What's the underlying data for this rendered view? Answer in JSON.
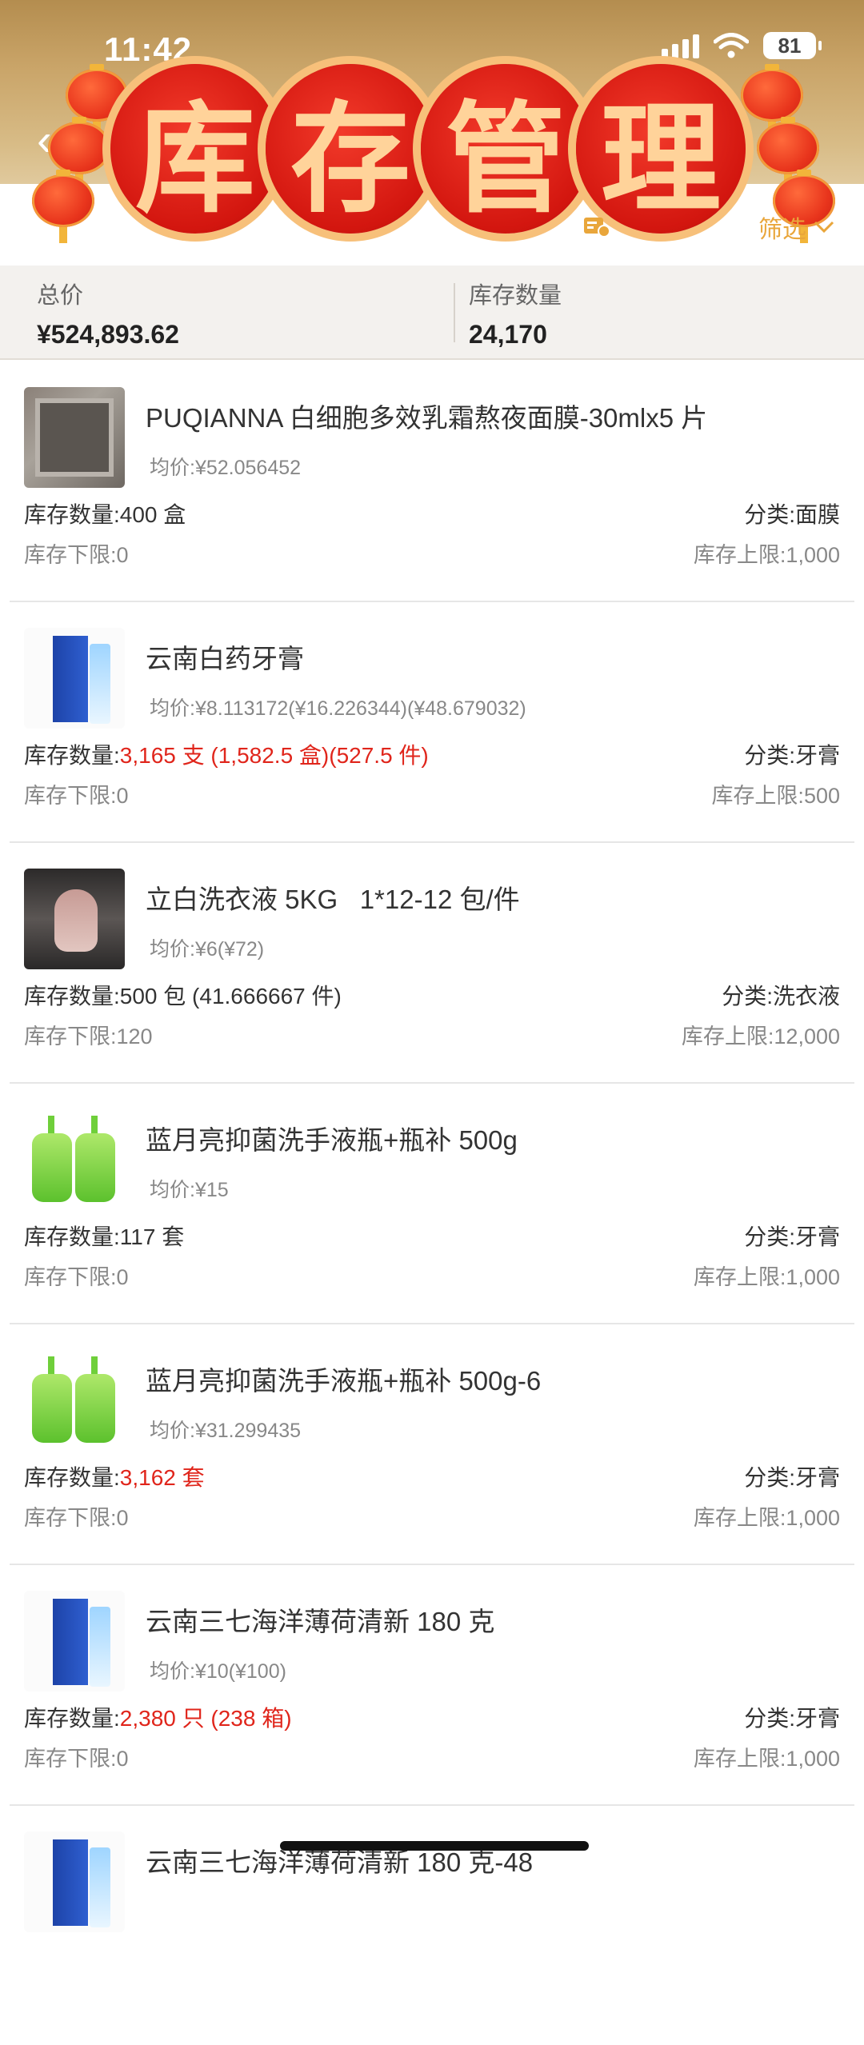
{
  "status_bar": {
    "time": "11:42",
    "battery": "81"
  },
  "header": {
    "title_chars": [
      "库",
      "存",
      "管",
      "理"
    ],
    "filter_label": "筛选"
  },
  "summary": {
    "total_label": "总价",
    "total_value": "¥524,893.62",
    "qty_label": "库存数量",
    "qty_value": "24,170"
  },
  "items": [
    {
      "name": "PUQIANNA 白细胞多效乳霜熬夜面膜-30mlx5 片",
      "price": "均价:¥52.056452",
      "stock_label": "库存数量:",
      "stock_value": "400 盒",
      "stock_red": false,
      "category": "分类:面膜",
      "min": "库存下限:0",
      "max": "库存上限:1,000",
      "thumb": "mask-photo"
    },
    {
      "name": "云南白药牙膏",
      "price": "均价:¥8.113172(¥16.226344)(¥48.679032)",
      "stock_label": "库存数量:",
      "stock_value": "3,165 支 (1,582.5 盒)(527.5 件)",
      "stock_red": true,
      "category": "分类:牙膏",
      "min": "库存下限:0",
      "max": "库存上限:500",
      "thumb": "toothpaste-photo"
    },
    {
      "name": "立白洗衣液 5KG   1*12-12 包/件",
      "price": "均价:¥6(¥72)",
      "stock_label": "库存数量:",
      "stock_value": "500 包 (41.666667 件)",
      "stock_red": false,
      "category": "分类:洗衣液",
      "min": "库存下限:120",
      "max": "库存上限:12,000",
      "thumb": "laundry-photo"
    },
    {
      "name": "蓝月亮抑菌洗手液瓶+瓶补 500g",
      "price": "均价:¥15",
      "stock_label": "库存数量:",
      "stock_value": "117 套",
      "stock_red": false,
      "category": "分类:牙膏",
      "min": "库存下限:0",
      "max": "库存上限:1,000",
      "thumb": "handsoap-photo"
    },
    {
      "name": "蓝月亮抑菌洗手液瓶+瓶补 500g-6",
      "price": "均价:¥31.299435",
      "stock_label": "库存数量:",
      "stock_value": "3,162 套",
      "stock_red": true,
      "category": "分类:牙膏",
      "min": "库存下限:0",
      "max": "库存上限:1,000",
      "thumb": "handsoap-photo"
    },
    {
      "name": "云南三七海洋薄荷清新 180 克",
      "price": "均价:¥10(¥100)",
      "stock_label": "库存数量:",
      "stock_value": "2,380 只 (238 箱)",
      "stock_red": true,
      "category": "分类:牙膏",
      "min": "库存下限:0",
      "max": "库存上限:1,000",
      "thumb": "toothpaste-photo"
    },
    {
      "name": "云南三七海洋薄荷清新 180 克-48",
      "price": "",
      "stock_label": "",
      "stock_value": "",
      "stock_red": false,
      "category": "",
      "min": "",
      "max": "",
      "thumb": "toothpaste-photo"
    }
  ]
}
